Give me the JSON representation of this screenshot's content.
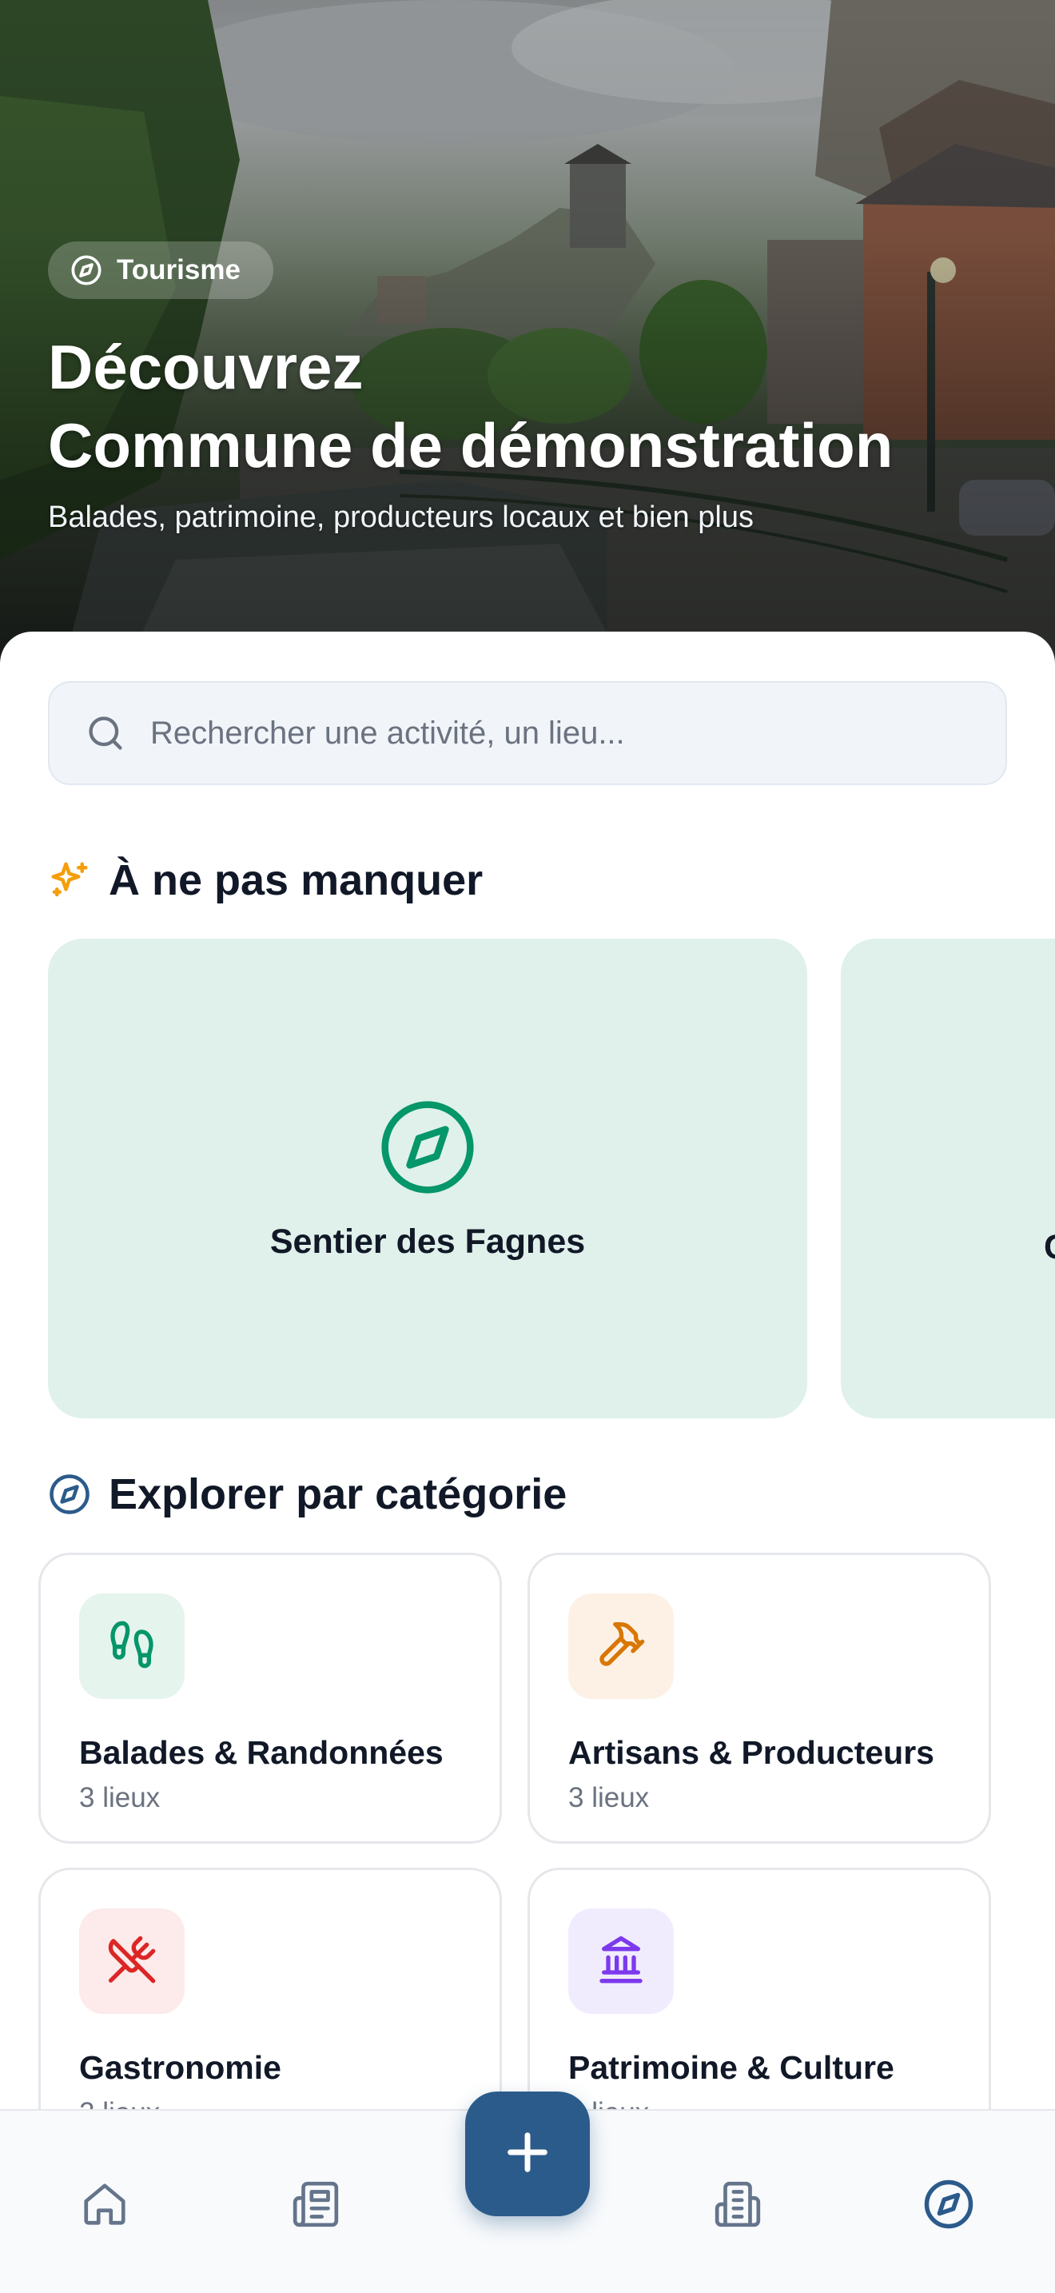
{
  "hero": {
    "badge": {
      "label": "Tourisme",
      "icon": "compass-icon"
    },
    "title_line1": "Découvrez",
    "title_line2": "Commune de démonstration",
    "subtitle": "Balades, patrimoine, producteurs locaux et bien plus"
  },
  "search": {
    "placeholder": "Rechercher une activité, un lieu...",
    "icon": "search-icon"
  },
  "featured": {
    "title": "À ne pas manquer",
    "icon": "sparkles-icon",
    "cards": [
      {
        "title": "Sentier des Fagnes",
        "icon": "compass-icon"
      },
      {
        "title": "C",
        "icon": "compass-icon"
      }
    ]
  },
  "categories": {
    "title": "Explorer par catégorie",
    "icon": "compass-icon",
    "items": [
      {
        "name": "Balades & Randonnées",
        "count": "3 lieux",
        "icon": "footprints-icon",
        "color": "#059669",
        "bg": "#e6f4ee"
      },
      {
        "name": "Artisans & Producteurs",
        "count": "3 lieux",
        "icon": "hammer-icon",
        "color": "#d97706",
        "bg": "#fdf1e6"
      },
      {
        "name": "Gastronomie",
        "count": "2 lieux",
        "icon": "utensils-crossed-icon",
        "color": "#dc2626",
        "bg": "#fdeaea"
      },
      {
        "name": "Patrimoine & Culture",
        "count": "2 lieux",
        "icon": "landmark-icon",
        "color": "#7c3aed",
        "bg": "#f1ecfd"
      }
    ]
  },
  "bottom_nav": {
    "items": [
      {
        "icon": "home-icon",
        "active": false
      },
      {
        "icon": "newspaper-icon",
        "active": false
      },
      {
        "icon": "plus-icon",
        "active": false
      },
      {
        "icon": "building-icon",
        "active": false
      },
      {
        "icon": "compass-icon",
        "active": true
      }
    ],
    "active_color": "#2b5b8a",
    "inactive_color": "#64748b"
  },
  "colors": {
    "accent": "#2b5b8a",
    "featured_bg": "#dff1ea",
    "featured_icon": "#059669",
    "sparkle": "#f59e0b"
  }
}
